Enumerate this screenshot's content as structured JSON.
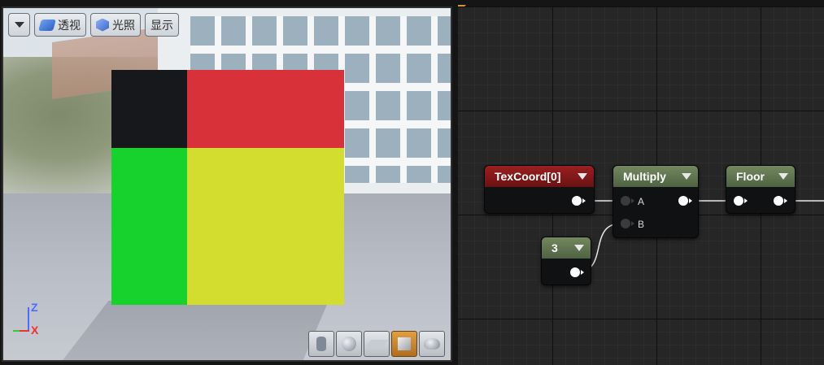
{
  "viewport": {
    "toolbar": {
      "menu_icon": "chevron-down-icon",
      "perspective_label": "透视",
      "lit_label": "光照",
      "show_label": "显示"
    },
    "axis": {
      "z": "Z",
      "x": "X"
    },
    "colors": {
      "top_left": "#16181c",
      "top_right": "#d9313a",
      "bottom_left": "#17d12c",
      "bottom_right": "#d3dd2f"
    },
    "preview_shapes": [
      "cylinder-icon",
      "sphere-icon",
      "plane-icon",
      "cube-icon",
      "teapot-icon"
    ],
    "active_shape": "cube-icon"
  },
  "graph": {
    "nodes": {
      "texcoord": {
        "title": "TexCoord[0]",
        "header_color": "#8b1a1b"
      },
      "multiply": {
        "title": "Multiply",
        "input_a": "A",
        "input_b": "B",
        "header_color": "#63764f"
      },
      "floor": {
        "title": "Floor",
        "header_color": "#63764f"
      },
      "constant": {
        "title": "3",
        "header_color": "#63764f"
      }
    },
    "wire_color": "#e8e8e8"
  }
}
